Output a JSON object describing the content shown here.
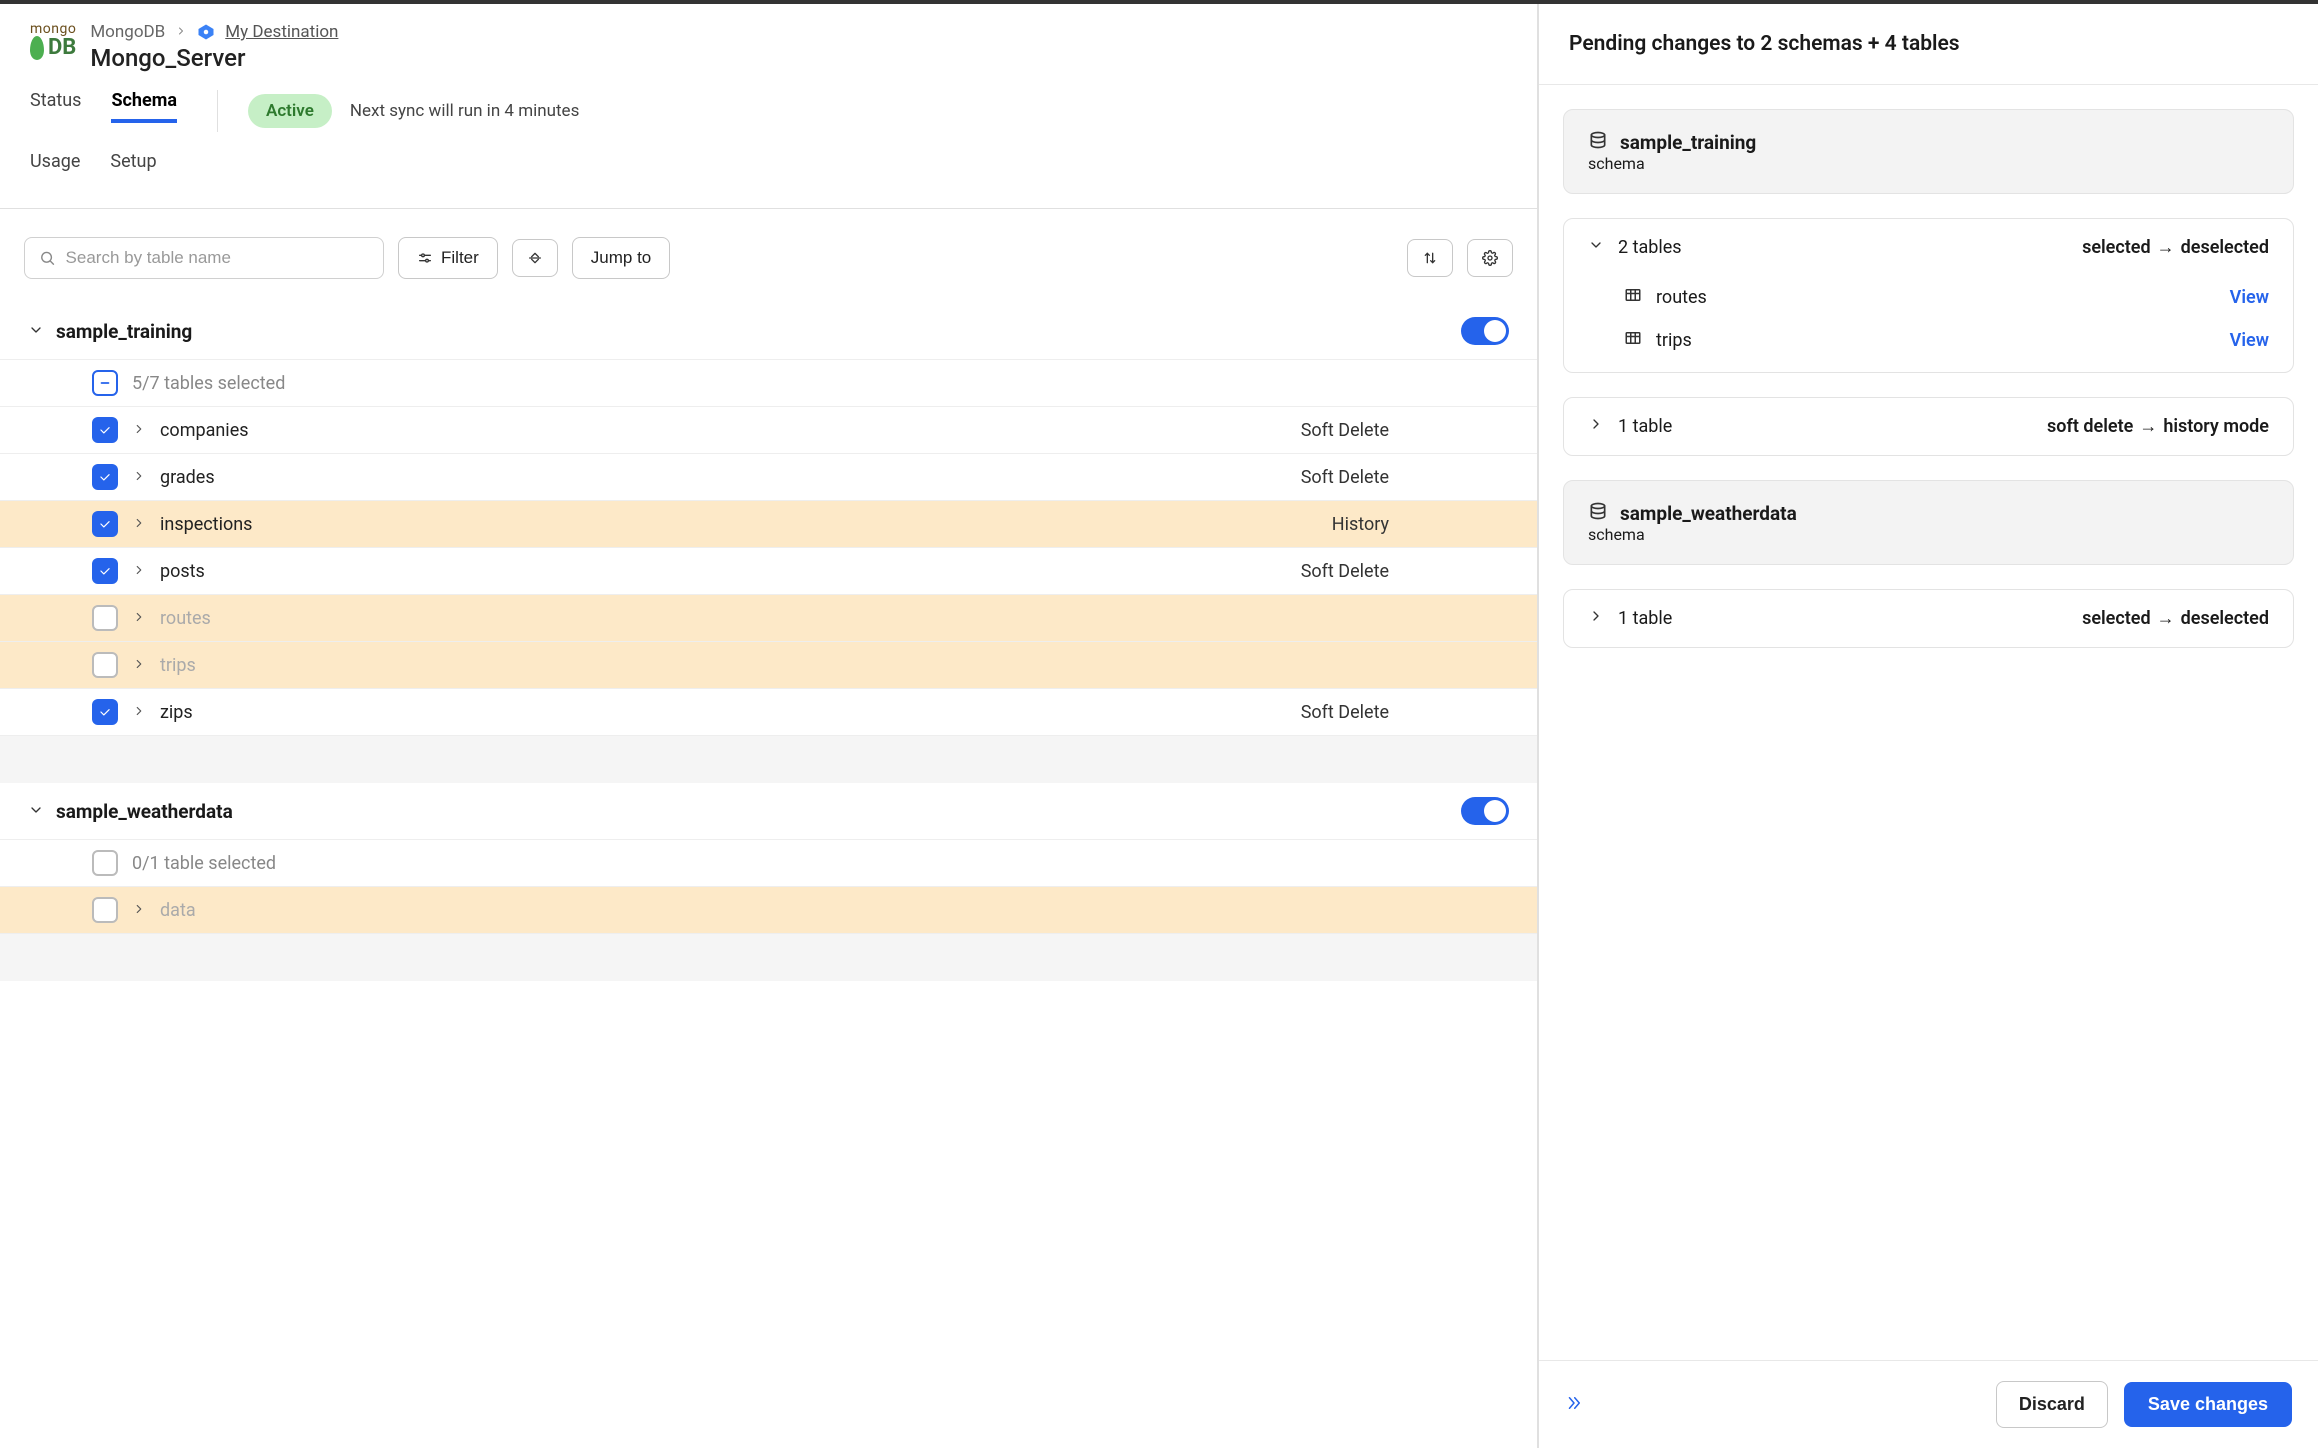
{
  "header": {
    "logo_top": "mongo",
    "logo_bottom": "DB",
    "crumb_source": "MongoDB",
    "crumb_dest": "My Destination",
    "connector_name": "Mongo_Server"
  },
  "tabs": {
    "status": "Status",
    "schema": "Schema",
    "usage": "Usage",
    "setup": "Setup"
  },
  "status": {
    "badge": "Active",
    "next_sync": "Next sync will run in 4 minutes"
  },
  "toolbar": {
    "search_placeholder": "Search by table name",
    "filter": "Filter",
    "jump": "Jump to"
  },
  "schemas": [
    {
      "name": "sample_training",
      "selected_summary": "5/7 tables selected",
      "tables": [
        {
          "name": "companies",
          "checked": true,
          "changed": false,
          "mode": "Soft Delete"
        },
        {
          "name": "grades",
          "checked": true,
          "changed": false,
          "mode": "Soft Delete"
        },
        {
          "name": "inspections",
          "checked": true,
          "changed": true,
          "mode": "History"
        },
        {
          "name": "posts",
          "checked": true,
          "changed": false,
          "mode": "Soft Delete"
        },
        {
          "name": "routes",
          "checked": false,
          "changed": true,
          "mode": ""
        },
        {
          "name": "trips",
          "checked": false,
          "changed": true,
          "mode": ""
        },
        {
          "name": "zips",
          "checked": true,
          "changed": false,
          "mode": "Soft Delete"
        }
      ]
    },
    {
      "name": "sample_weatherdata",
      "selected_summary": "0/1 table selected",
      "tables": [
        {
          "name": "data",
          "checked": false,
          "changed": true,
          "mode": ""
        }
      ]
    }
  ],
  "pending": {
    "title": "Pending changes to 2 schemas + 4 tables",
    "view_label": "View",
    "schema_type_label": "schema",
    "groups": [
      {
        "schema": "sample_training",
        "changes": [
          {
            "summary": "2 tables",
            "from": "selected",
            "to": "deselected",
            "items": [
              "routes",
              "trips"
            ]
          },
          {
            "summary": "1 table",
            "from": "soft delete",
            "to": "history mode",
            "items": []
          }
        ]
      },
      {
        "schema": "sample_weatherdata",
        "changes": [
          {
            "summary": "1 table",
            "from": "selected",
            "to": "deselected",
            "items": []
          }
        ]
      }
    ]
  },
  "footer": {
    "discard": "Discard",
    "save": "Save changes"
  }
}
